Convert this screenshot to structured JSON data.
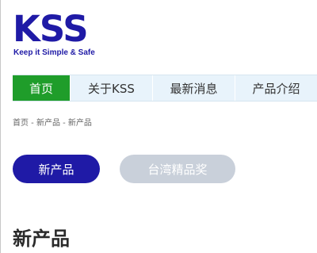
{
  "logo": {
    "mark": "KSS",
    "tagline": "Keep it Simple & Safe"
  },
  "nav": {
    "items": [
      {
        "label": "首页"
      },
      {
        "label": "关于KSS"
      },
      {
        "label": "最新消息"
      },
      {
        "label": "产品介绍"
      }
    ],
    "active_color": "#1f9d2a"
  },
  "breadcrumb": {
    "text": "首页 - 新产品 - 新产品"
  },
  "tabs": {
    "items": [
      {
        "label": "新产品"
      },
      {
        "label": "台湾精品奖"
      }
    ]
  },
  "section": {
    "title": "新产品"
  },
  "colors": {
    "brand": "#1f1aa6",
    "tab_inactive": "#c9d0da",
    "nav_background": "#e8f3fb"
  }
}
